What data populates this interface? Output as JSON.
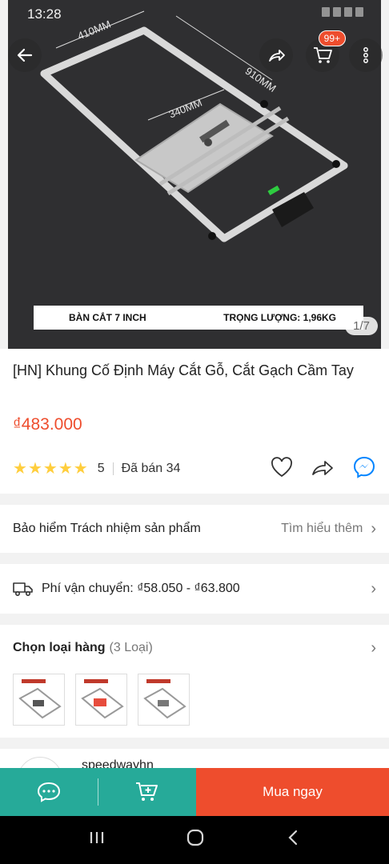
{
  "status_bar": {
    "time": "13:28"
  },
  "header": {
    "cart_badge": "99+"
  },
  "product_image": {
    "dim_top": "410MM",
    "dim_right": "910MM",
    "dim_middle": "340MM",
    "caption_left": "BÀN CẮT 7 INCH",
    "caption_right": "TRỌNG LƯỢNG: 1,96KG",
    "counter": "1/7"
  },
  "product": {
    "title": "[HN] Khung Cố Định Máy Cắt Gỗ, Cắt Gạch Cầm Tay",
    "price": "₫483.000",
    "rating": "5",
    "rating_stars": 5,
    "sold": "Đã bán 34"
  },
  "insurance": {
    "label": "Bảo hiểm Trách nhiệm sản phẩm",
    "link": "Tìm hiểu thêm"
  },
  "shipping": {
    "label": "Phí vận chuyển: ₫58.050 - ₫63.800"
  },
  "variants": {
    "label": "Chọn loại hàng",
    "count": "(3 Loại)"
  },
  "shop": {
    "name": "speedwayhn"
  },
  "bottom_bar": {
    "buy_label": "Mua ngay"
  },
  "colors": {
    "accent": "#ee4d2d",
    "teal": "#26aa99",
    "star": "#ffce3d"
  }
}
